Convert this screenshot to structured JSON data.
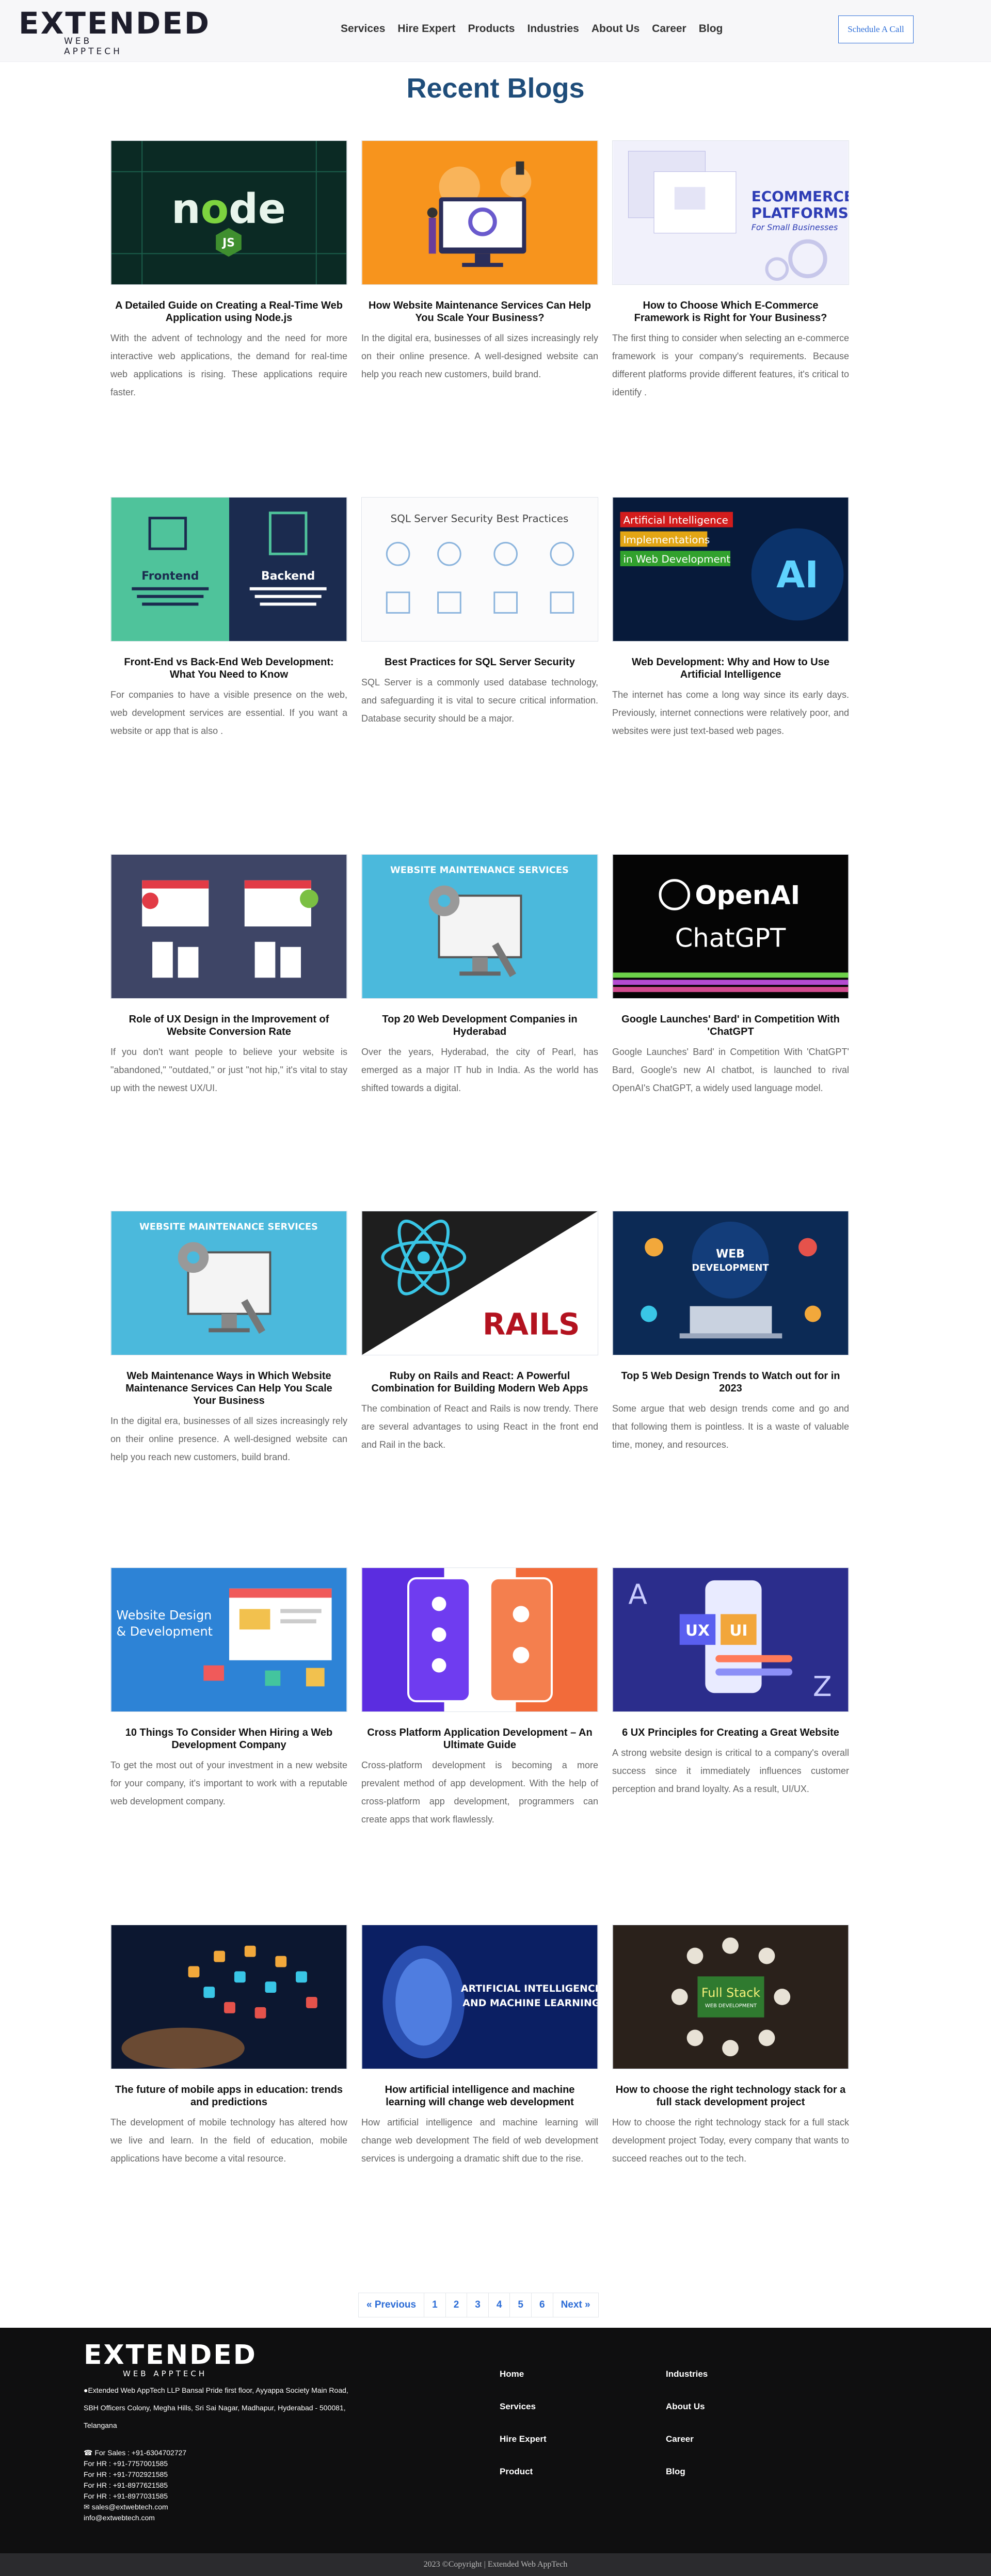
{
  "header": {
    "logo_text": "EXTENDED",
    "logo_tag": "WEB APPTECH",
    "nav": [
      "Services",
      "Hire Expert",
      "Products",
      "Industries",
      "About Us",
      "Career",
      "Blog"
    ],
    "cta": "Schedule A Call"
  },
  "page_title": "Recent Blogs",
  "posts": [
    {
      "title": "A Detailed Guide on Creating a Real-Time Web Application using Node.js",
      "excerpt": "With the advent of technology and the need for more interactive web applications, the demand for real-time web applications is rising. These applications require faster.",
      "image": "nodejs-art"
    },
    {
      "title": "How Website Maintenance Services Can Help You Scale Your Business?",
      "excerpt": "In the digital era, businesses of all sizes increasingly rely on their online presence. A well-designed website can help you reach new customers, build brand.",
      "image": "maintenance-update-art"
    },
    {
      "title": "How to Choose Which E-Commerce Framework is Right for Your Business?",
      "excerpt": "The first thing to consider when selecting an e-commerce framework is your company's requirements. Because different platforms provide different features, it's critical to identify .",
      "image": "ecommerce-platforms-art",
      "image_text": [
        "ECOMMERCE",
        "PLATFORMS",
        "For Small Businesses"
      ]
    },
    {
      "title": "Front-End vs Back-End Web Development: What You Need to Know",
      "excerpt": "For companies to have a visible presence on the web, web development services are essential. If you want a website or app that is also .",
      "image": "frontend-backend-art",
      "image_text": [
        "Frontend",
        "Backend"
      ]
    },
    {
      "title": "Best Practices for SQL Server Security",
      "excerpt": "SQL Server is a commonly used database technology, and safeguarding it is vital to secure critical information. Database security should be a major.",
      "image": "sql-security-art",
      "image_text": [
        "SQL Server Security Best Practices"
      ]
    },
    {
      "title": "Web Development: Why and How to Use Artificial Intelligence",
      "excerpt": "The internet has come a long way since its early days. Previously, internet connections were relatively poor, and websites were just text-based web pages.",
      "image": "ai-web-art",
      "image_text": [
        "Artificial Intelligence",
        "Implementations",
        "in Web Development",
        "AI"
      ]
    },
    {
      "title": "Role of UX Design in the Improvement of Website Conversion Rate",
      "excerpt": "If you don't want people to believe your website is \"abandoned,\" \"outdated,\" or just \"not hip,\" it's vital to stay up with the newest UX/UI.",
      "image": "ux-conversion-art"
    },
    {
      "title": "Top 20 Web Development Companies in Hyderabad",
      "excerpt": "Over the years, Hyderabad, the city of Pearl, has emerged as a major IT hub in India. As the world has shifted towards a digital.",
      "image": "website-maintenance-art",
      "image_text": [
        "WEBSITE MAINTENANCE SERVICES"
      ]
    },
    {
      "title": "Google Launches' Bard' in Competition With 'ChatGPT",
      "excerpt": "Google Launches' Bard' in Competition With 'ChatGPT' Bard, Google's new AI chatbot, is launched to rival OpenAI's ChatGPT, a widely used language model.",
      "image": "openai-chatgpt-art",
      "image_text": [
        "OpenAI",
        "ChatGPT"
      ]
    },
    {
      "title": "Web Maintenance Ways in Which Website Maintenance Services Can Help You Scale Your Business",
      "excerpt": "In the digital era, businesses of all sizes increasingly rely on their online presence. A well-designed website can help you reach new customers, build brand.",
      "image": "website-maintenance-art",
      "image_text": [
        "WEBSITE MAINTENANCE SERVICES"
      ]
    },
    {
      "title": "Ruby on Rails and React: A Powerful Combination for Building Modern Web Apps",
      "excerpt": "The combination of React and Rails is now trendy. There are several advantages to using React in the front end and Rail in the back.",
      "image": "react-rails-art",
      "image_text": [
        "RAILS"
      ]
    },
    {
      "title": "Top 5 Web Design Trends to Watch out for in 2023",
      "excerpt": "Some argue that web design trends come and go and that following them is pointless. It is a waste of valuable time, money, and resources.",
      "image": "web-development-art",
      "image_text": [
        "WEB",
        "DEVELOPMENT"
      ]
    },
    {
      "title": "10 Things To Consider When Hiring a Web Development Company",
      "excerpt": "To get the most out of your investment in a new website for your company, it's important to work with a reputable web development company.",
      "image": "website-design-art",
      "image_text": [
        "Website Design",
        "& Development"
      ]
    },
    {
      "title": "Cross Platform Application Development – An Ultimate Guide",
      "excerpt": "Cross-platform development is becoming a more prevalent method of app development. With the help of cross-platform app development, programmers can create apps that work flawlessly.",
      "image": "cross-platform-art"
    },
    {
      "title": "6 UX Principles for Creating a Great Website",
      "excerpt": "A strong website design is critical to a company's overall success since it immediately influences customer perception and brand loyalty. As a result, UI/UX.",
      "image": "ux-ui-art",
      "image_text": [
        "UX",
        "UI"
      ]
    },
    {
      "title": "The future of mobile apps in education: trends and predictions",
      "excerpt": "The development of mobile technology has altered how we live and learn. In the field of education, mobile applications have become a vital resource.",
      "image": "mobile-apps-art"
    },
    {
      "title": "How artificial intelligence and machine learning will change web development",
      "excerpt": "How artificial intelligence and machine learning will change web development The field of web development services is undergoing a dramatic shift due to the rise.",
      "image": "ai-ml-art",
      "image_text": [
        "ARTIFICIAL INTELLIGENCE",
        "AND MACHINE LEARNING"
      ]
    },
    {
      "title": "How to choose the right technology stack for a full stack development project",
      "excerpt": "How to choose the right technology stack for a full stack development project Today, every company that wants to succeed reaches out to the tech.",
      "image": "full-stack-art",
      "image_text": [
        "Full Stack",
        "WEB DEVELOPMENT"
      ]
    }
  ],
  "pagination": [
    "« Previous",
    "1",
    "2",
    "3",
    "4",
    "5",
    "6",
    "Next »"
  ],
  "footer": {
    "address_lines": [
      "Extended Web AppTech LLP Bansal Pride first floor, Ayyappa Society Main Road,",
      "SBH Officers Colony, Megha Hills, Sri Sai Nagar, Madhapur, Hyderabad - 500081,",
      "Telangana"
    ],
    "contacts": [
      "For Sales : +91-6304702727",
      "For HR : +91-7757001585",
      "For HR : +91-7702921585",
      "For HR : +91-8977621585",
      "For HR : +91-8977031585",
      "sales@extwebtech.com",
      "info@extwebtech.com"
    ],
    "col1": [
      "Home",
      "Services",
      "Hire Expert",
      "Product"
    ],
    "col2": [
      "Industries",
      "About Us",
      "Career",
      "Blog"
    ],
    "copyright": "2023 ©Copyright | Extended Web AppTech"
  },
  "colors": {
    "title": "#1f4d7a",
    "link": "#2a6bd6",
    "footer_bg": "#0f0f10"
  }
}
